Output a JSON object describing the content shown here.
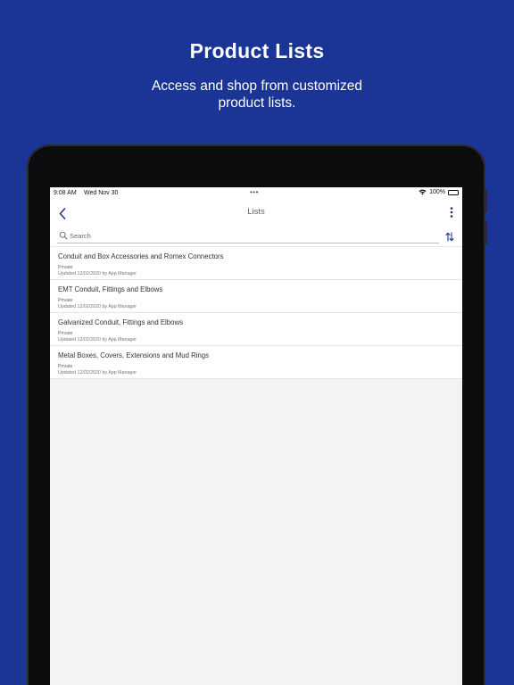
{
  "hero": {
    "title": "Product Lists",
    "subtitle": "Access and shop from customized product lists."
  },
  "status_bar": {
    "time": "9:08 AM",
    "date": "Wed Nov 30",
    "dots": "•••",
    "battery": "100%"
  },
  "nav": {
    "title": "Lists",
    "back_icon": "chevron-left-icon",
    "more_icon": "vertical-ellipsis-icon"
  },
  "search": {
    "placeholder": "Search",
    "icon": "search-icon",
    "sort_icon": "sort-arrows-icon"
  },
  "lists": [
    {
      "title": "Conduit and Box Accessories and Romex Connectors",
      "visibility": "Private",
      "updated": "Updated 12/02/2020 by App Manager"
    },
    {
      "title": "EMT Conduit, Fittings and Elbows",
      "visibility": "Private",
      "updated": "Updated 12/02/2020 by App Manager"
    },
    {
      "title": "Galvanized Conduit, Fittings and Elbows",
      "visibility": "Private",
      "updated": "Updated 12/02/2020 by App Manager"
    },
    {
      "title": "Metal Boxes, Covers, Extensions and Mud Rings",
      "visibility": "Private",
      "updated": "Updated 12/02/2020 by App Manager"
    }
  ],
  "colors": {
    "background": "#1a3596",
    "accent": "#1c3a8c",
    "screen_background": "#f3f3f4"
  }
}
